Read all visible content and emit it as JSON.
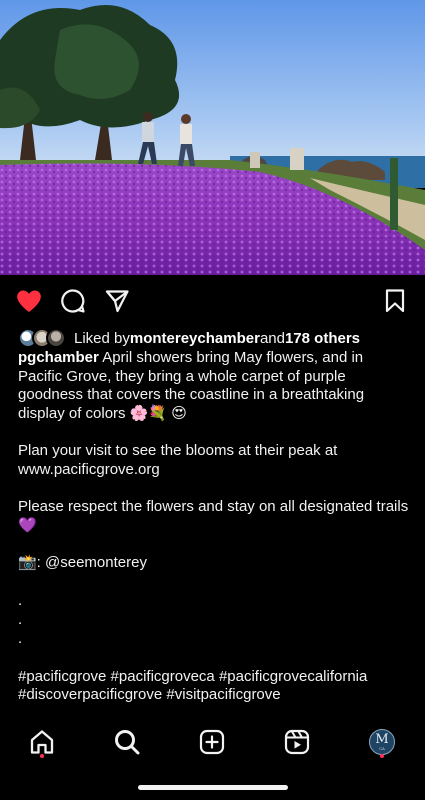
{
  "post": {
    "image_alt": "Couple walking across a field of purple flowers on the Pacific Grove coastline",
    "liked": true
  },
  "actions": {
    "like_icon": "heart-filled-icon",
    "comment_icon": "comment-icon",
    "share_icon": "paper-plane-icon",
    "save_icon": "bookmark-icon"
  },
  "likes": {
    "prefix": "Liked by ",
    "user": "montereychamber",
    "middle": " and ",
    "others": "178 others"
  },
  "caption": {
    "author": "pgchamber",
    "text": " April showers bring May flowers, and in Pacific Grove, they bring a whole carpet of purple goodness that covers the coastline in a breathtaking display of colors 🌸💐 😍",
    "para2": "Plan your visit to see the blooms at their peak at www.pacificgrove.org",
    "para3": "Please respect the flowers and stay on all designated trails 💜",
    "credit": "📸: @seemonterey",
    "dot1": ".",
    "dot2": ".",
    "dot3": ".",
    "hashtags_line1": "#pacificgrove #pacificgroveca #pacificgrovecalifornia",
    "hashtags_line2": "#discoverpacificgrove #visitpacificgrove"
  },
  "tabbar": {
    "home_icon": "home-icon",
    "search_icon": "search-icon",
    "create_icon": "plus-square-icon",
    "reels_icon": "reels-icon",
    "profile_initial": "M",
    "profile_sub": "CA"
  },
  "colors": {
    "like_red": "#ff3040",
    "notification_dot": "#ff2d55",
    "background": "#000000"
  }
}
